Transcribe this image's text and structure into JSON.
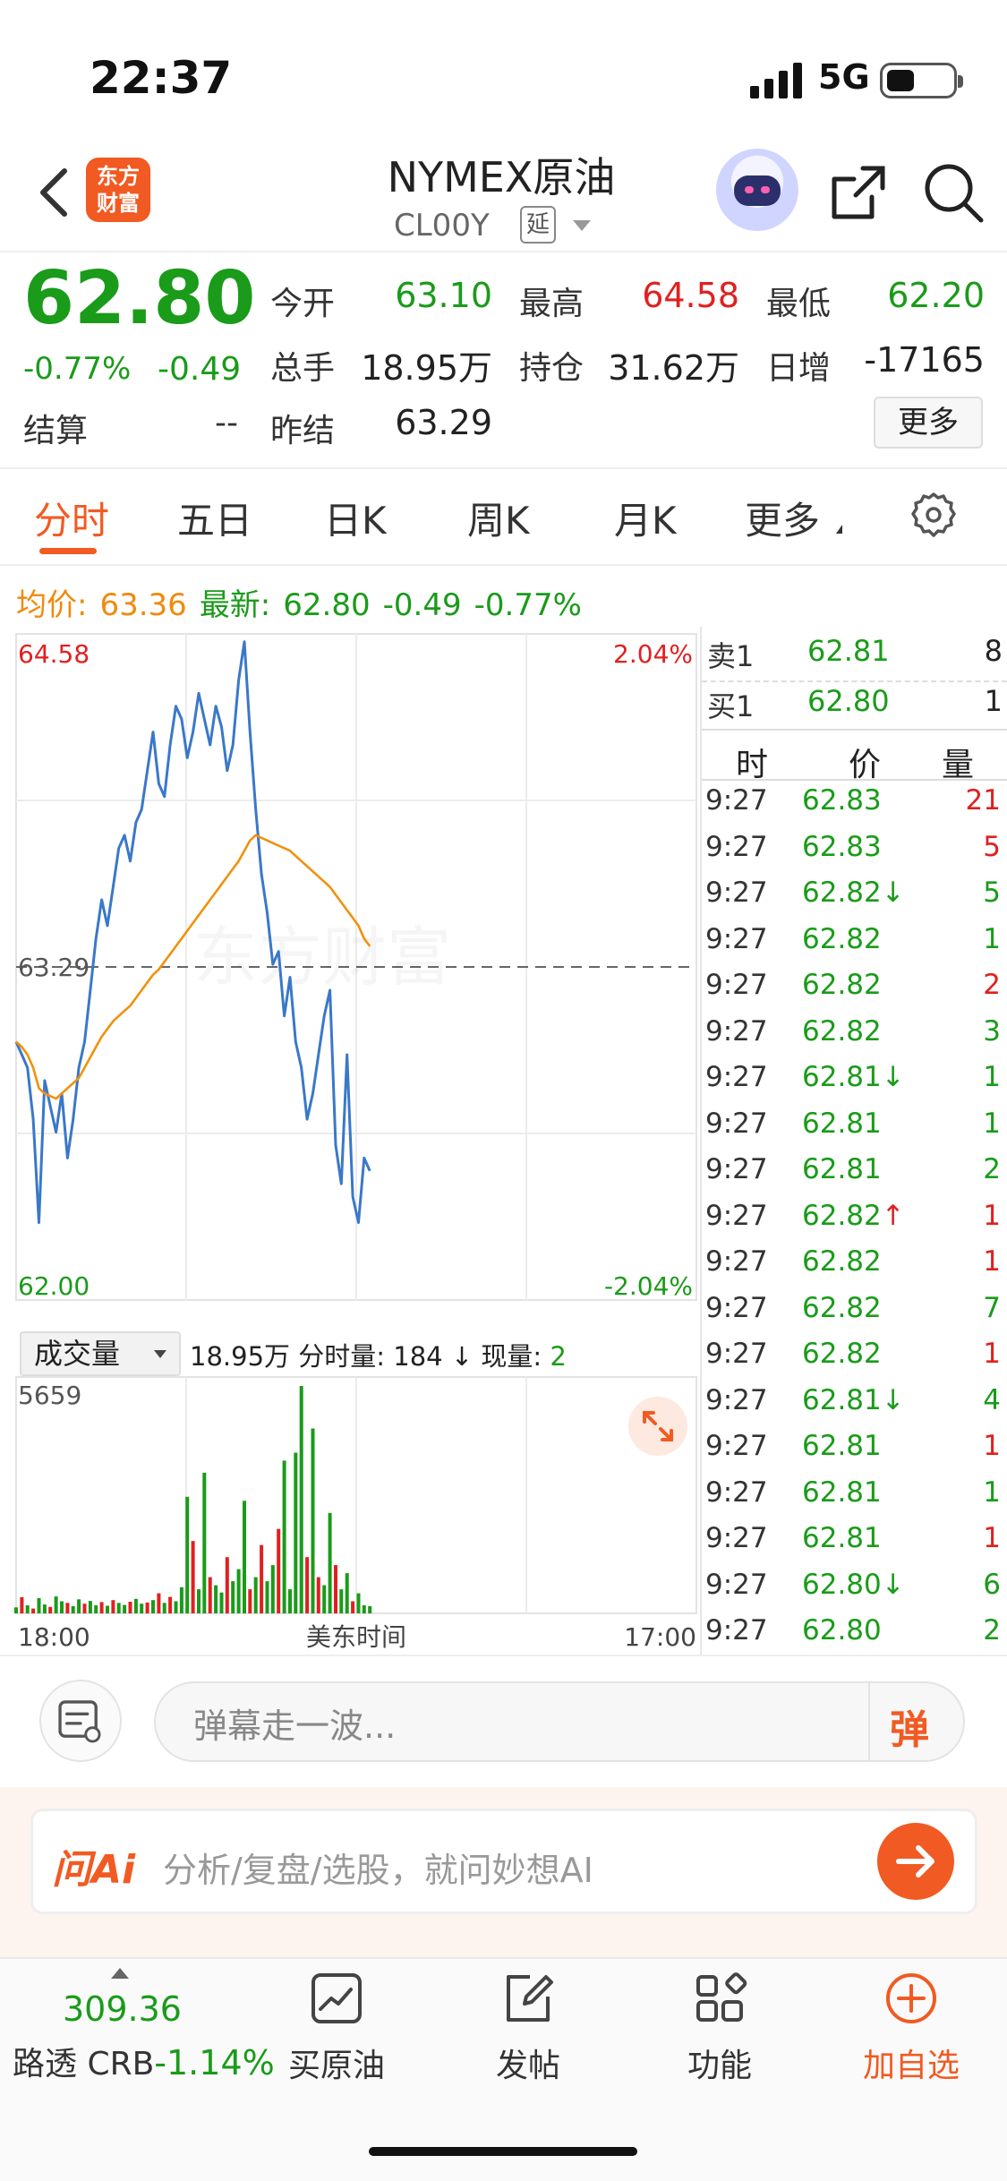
{
  "status_bar": {
    "time": "22:37",
    "network": "5G"
  },
  "header": {
    "logo_text": "东方\n财富",
    "title": "NYMEX原油",
    "code": "CL00Y",
    "delay_badge": "延"
  },
  "quote": {
    "price": "62.80",
    "change_pct": "-0.77%",
    "change_value": "-0.49",
    "settle_label": "结算",
    "settle_value": "--",
    "prev_settle_label": "昨结",
    "prev_settle_value": "63.29",
    "open_label": "今开",
    "open_value": "63.10",
    "high_label": "最高",
    "high_value": "64.58",
    "low_label": "最低",
    "low_value": "62.20",
    "volume_label": "总手",
    "volume_value": "18.95万",
    "oi_label": "持仓",
    "oi_value": "31.62万",
    "daily_inc_label": "日增",
    "daily_inc_value": "-17165",
    "more_button": "更多"
  },
  "tabs": [
    "分时",
    "五日",
    "日K",
    "周K",
    "月K",
    "更多"
  ],
  "summary": {
    "avg_label": "均价:",
    "avg_value": "63.36",
    "latest_label": "最新:",
    "latest_value": "62.80",
    "chg_value": "-0.49",
    "chg_pct": "-0.77%"
  },
  "chart_data": {
    "type": "line",
    "title": "",
    "y_max_label": "64.58",
    "y_min_label": "62.00",
    "y_ref_label": "63.29",
    "pct_max_label": "2.04%",
    "pct_min_label": "-2.04%",
    "ylim": [
      62.0,
      64.58
    ],
    "prev_close": 63.29,
    "x_labels": [
      "18:00",
      "美东时间",
      "17:00"
    ],
    "watermark": "东方财富",
    "series": [
      {
        "name": "最新",
        "color": "#3a78c8",
        "values": [
          63.0,
          62.95,
          62.9,
          62.7,
          62.3,
          62.85,
          62.75,
          62.65,
          62.8,
          62.55,
          62.7,
          62.9,
          63.0,
          63.2,
          63.4,
          63.55,
          63.45,
          63.6,
          63.75,
          63.8,
          63.7,
          63.85,
          63.9,
          64.05,
          64.2,
          64.0,
          63.95,
          64.15,
          64.3,
          64.25,
          64.1,
          64.2,
          64.35,
          64.25,
          64.15,
          64.3,
          64.22,
          64.05,
          64.15,
          64.4,
          64.55,
          64.2,
          63.9,
          63.65,
          63.5,
          63.3,
          63.35,
          63.1,
          63.25,
          63.0,
          62.9,
          62.7,
          62.8,
          62.95,
          63.1,
          63.2,
          62.6,
          62.45,
          62.95,
          62.4,
          62.3,
          62.55,
          62.5
        ]
      },
      {
        "name": "均价",
        "color": "#f0920c",
        "values": [
          63.0,
          62.98,
          62.95,
          62.9,
          62.82,
          62.8,
          62.79,
          62.78,
          62.8,
          62.82,
          62.84,
          62.86,
          62.9,
          62.94,
          62.98,
          63.02,
          63.05,
          63.08,
          63.1,
          63.12,
          63.14,
          63.17,
          63.2,
          63.23,
          63.26,
          63.28,
          63.31,
          63.34,
          63.37,
          63.4,
          63.43,
          63.46,
          63.49,
          63.52,
          63.55,
          63.58,
          63.61,
          63.64,
          63.67,
          63.7,
          63.74,
          63.78,
          63.8,
          63.79,
          63.78,
          63.77,
          63.76,
          63.75,
          63.74,
          63.72,
          63.7,
          63.68,
          63.66,
          63.64,
          63.62,
          63.6,
          63.57,
          63.54,
          63.51,
          63.48,
          63.45,
          63.4,
          63.37
        ]
      }
    ],
    "volume": {
      "label": "成交量",
      "total": "18.95万",
      "period_label": "分时量:",
      "period_value": "184",
      "period_dir": "↓",
      "now_label": "现量:",
      "now_value": "2",
      "max_label": "5659",
      "values": [
        150,
        400,
        200,
        120,
        380,
        220,
        160,
        420,
        300,
        260,
        180,
        350,
        240,
        310,
        200,
        280,
        190,
        330,
        260,
        210,
        290,
        360,
        240,
        270,
        330,
        500,
        260,
        410,
        300,
        650,
        2900,
        1800,
        600,
        3500,
        900,
        700,
        520,
        1400,
        800,
        1100,
        2800,
        600,
        900,
        1700,
        800,
        1200,
        2100,
        3800,
        600,
        4000,
        5659,
        1400,
        4600,
        900,
        700,
        2500,
        1200,
        600,
        1000,
        300,
        500,
        200,
        180
      ],
      "colors": [
        "green",
        "red",
        "green",
        "red",
        "green",
        "green",
        "red",
        "green",
        "green",
        "red",
        "green",
        "green",
        "red",
        "green",
        "green",
        "red",
        "green",
        "red",
        "green",
        "green",
        "red",
        "green",
        "green",
        "red",
        "green",
        "red",
        "green",
        "red",
        "green",
        "green",
        "green",
        "red",
        "green",
        "green",
        "red",
        "green",
        "green",
        "red",
        "green",
        "green",
        "green",
        "red",
        "green",
        "red",
        "green",
        "green",
        "red",
        "green",
        "green",
        "green",
        "green",
        "red",
        "green",
        "red",
        "green",
        "green",
        "red",
        "green",
        "green",
        "red",
        "green",
        "green",
        "green"
      ]
    }
  },
  "order_book": {
    "sell1": {
      "label": "卖1",
      "price": "62.81",
      "vol": "8"
    },
    "buy1": {
      "label": "买1",
      "price": "62.80",
      "vol": "1"
    }
  },
  "trades_header": [
    "时",
    "价",
    "量"
  ],
  "trades": [
    {
      "t": "9:27",
      "p": "62.83",
      "arrow": "",
      "v": "21",
      "c": "red"
    },
    {
      "t": "9:27",
      "p": "62.83",
      "arrow": "",
      "v": "5",
      "c": "red"
    },
    {
      "t": "9:27",
      "p": "62.82",
      "arrow": "↓",
      "v": "5",
      "c": "green"
    },
    {
      "t": "9:27",
      "p": "62.82",
      "arrow": "",
      "v": "1",
      "c": "green"
    },
    {
      "t": "9:27",
      "p": "62.82",
      "arrow": "",
      "v": "2",
      "c": "red"
    },
    {
      "t": "9:27",
      "p": "62.82",
      "arrow": "",
      "v": "3",
      "c": "green"
    },
    {
      "t": "9:27",
      "p": "62.81",
      "arrow": "↓",
      "v": "1",
      "c": "green"
    },
    {
      "t": "9:27",
      "p": "62.81",
      "arrow": "",
      "v": "1",
      "c": "green"
    },
    {
      "t": "9:27",
      "p": "62.81",
      "arrow": "",
      "v": "2",
      "c": "green"
    },
    {
      "t": "9:27",
      "p": "62.82",
      "arrow": "↑",
      "v": "1",
      "c": "red"
    },
    {
      "t": "9:27",
      "p": "62.82",
      "arrow": "",
      "v": "1",
      "c": "red"
    },
    {
      "t": "9:27",
      "p": "62.82",
      "arrow": "",
      "v": "7",
      "c": "green"
    },
    {
      "t": "9:27",
      "p": "62.82",
      "arrow": "",
      "v": "1",
      "c": "red"
    },
    {
      "t": "9:27",
      "p": "62.81",
      "arrow": "↓",
      "v": "4",
      "c": "green"
    },
    {
      "t": "9:27",
      "p": "62.81",
      "arrow": "",
      "v": "1",
      "c": "red"
    },
    {
      "t": "9:27",
      "p": "62.81",
      "arrow": "",
      "v": "1",
      "c": "green"
    },
    {
      "t": "9:27",
      "p": "62.81",
      "arrow": "",
      "v": "1",
      "c": "red"
    },
    {
      "t": "9:27",
      "p": "62.80",
      "arrow": "↓",
      "v": "6",
      "c": "green"
    },
    {
      "t": "9:27",
      "p": "62.80",
      "arrow": "",
      "v": "2",
      "c": "green"
    }
  ],
  "danmaku": {
    "placeholder": "弹幕走一波...",
    "button": "弹"
  },
  "ai": {
    "logo": "问Ai",
    "placeholder": "分析/复盘/选股，就问妙想AI"
  },
  "bottom_nav": {
    "crb_value": "309.36",
    "crb_label": "路透 CRB",
    "crb_change": "-1.14%",
    "items": [
      {
        "label": "买原油",
        "icon": "chart-icon"
      },
      {
        "label": "发帖",
        "icon": "edit-icon"
      },
      {
        "label": "功能",
        "icon": "grid-icon"
      },
      {
        "label": "加自选",
        "icon": "add-circle-icon"
      }
    ]
  },
  "colors": {
    "up": "#e02020",
    "down": "#1a9b1a",
    "accent": "#f15a22",
    "avg": "#f08a0c",
    "line": "#3a78c8"
  }
}
